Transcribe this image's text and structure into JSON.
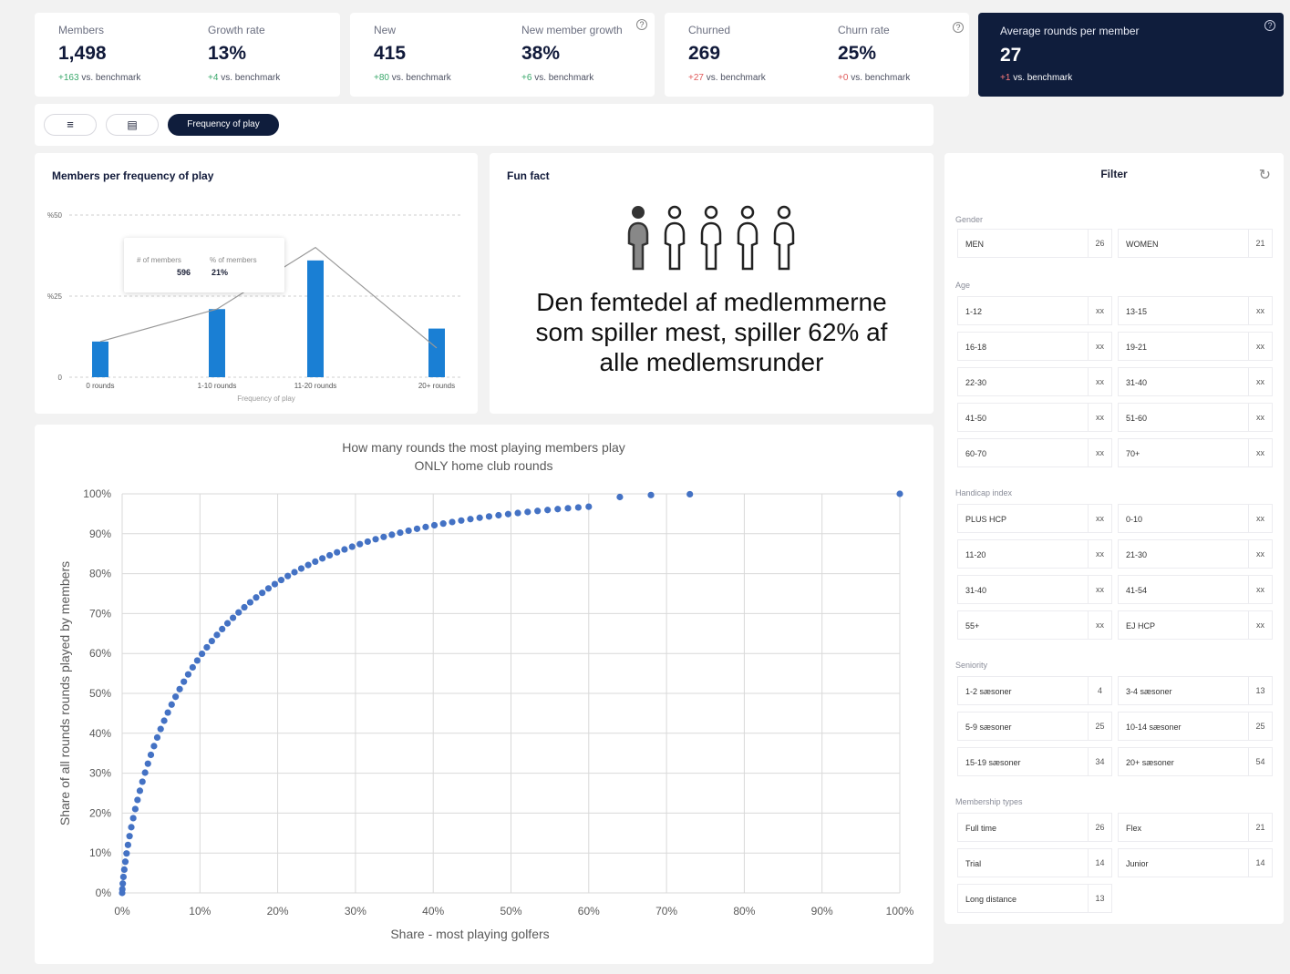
{
  "kpis": {
    "members": {
      "label": "Members",
      "value": "1,498",
      "delta": "+163",
      "suffix": "vs. benchmark"
    },
    "growth_rate": {
      "label": "Growth rate",
      "value": "13%",
      "delta": "+4",
      "suffix": "vs. benchmark"
    },
    "new": {
      "label": "New",
      "value": "415",
      "delta": "+80",
      "suffix": "vs. benchmark"
    },
    "new_member_growth": {
      "label": "New member growth",
      "value": "38%",
      "delta": "+6",
      "suffix": "vs. benchmark"
    },
    "churned": {
      "label": "Churned",
      "value": "269",
      "delta": "+27",
      "suffix": "vs. benchmark"
    },
    "churn_rate": {
      "label": "Churn rate",
      "value": "25%",
      "delta": "+0",
      "suffix": "vs. benchmark"
    },
    "avg_rounds": {
      "label": "Average rounds per member",
      "value": "27",
      "delta": "+1",
      "suffix": "vs. benchmark"
    }
  },
  "toolbar": {
    "list_icon": "list-icon",
    "comment_icon": "comment-icon",
    "active_tab": "Frequency of play"
  },
  "bar_card": {
    "title": "Members per frequency of play",
    "tooltip": {
      "col1_label": "# of members",
      "col2_label": "% of members",
      "col1_value": "596",
      "col2_value": "21%"
    }
  },
  "fun_fact": {
    "title": "Fun fact",
    "text_lines": [
      "Den femtedel af medlemmerne",
      "som spiller mest, spiller 62% af",
      "alle medlemsrunder"
    ]
  },
  "filter": {
    "title": "Filter",
    "reset_icon": "reset-icon",
    "sections": [
      {
        "label": "Gender",
        "options": [
          {
            "name": "MEN",
            "count": "26"
          },
          {
            "name": "WOMEN",
            "count": "21"
          }
        ]
      },
      {
        "label": "Age",
        "options": [
          {
            "name": "1-12",
            "count": "xx"
          },
          {
            "name": "13-15",
            "count": "xx"
          },
          {
            "name": "16-18",
            "count": "xx"
          },
          {
            "name": "19-21",
            "count": "xx"
          },
          {
            "name": "22-30",
            "count": "xx"
          },
          {
            "name": "31-40",
            "count": "xx"
          },
          {
            "name": "41-50",
            "count": "xx"
          },
          {
            "name": "51-60",
            "count": "xx"
          },
          {
            "name": "60-70",
            "count": "xx"
          },
          {
            "name": "70+",
            "count": "xx"
          }
        ]
      },
      {
        "label": "Handicap index",
        "options": [
          {
            "name": "PLUS HCP",
            "count": "xx"
          },
          {
            "name": "0-10",
            "count": "xx"
          },
          {
            "name": "11-20",
            "count": "xx"
          },
          {
            "name": "21-30",
            "count": "xx"
          },
          {
            "name": "31-40",
            "count": "xx"
          },
          {
            "name": "41-54",
            "count": "xx"
          },
          {
            "name": "55+",
            "count": "xx"
          },
          {
            "name": "EJ HCP",
            "count": "xx"
          }
        ]
      },
      {
        "label": "Seniority",
        "options": [
          {
            "name": "1-2 sæsoner",
            "count": "4"
          },
          {
            "name": "3-4 sæsoner",
            "count": "13"
          },
          {
            "name": "5-9 sæsoner",
            "count": "25"
          },
          {
            "name": "10-14 sæsoner",
            "count": "25"
          },
          {
            "name": "15-19 sæsoner",
            "count": "34"
          },
          {
            "name": "20+ sæsoner",
            "count": "54"
          }
        ]
      },
      {
        "label": "Membership types",
        "options": [
          {
            "name": "Full time",
            "count": "26"
          },
          {
            "name": "Flex",
            "count": "21"
          },
          {
            "name": "Trial",
            "count": "14"
          },
          {
            "name": "Junior",
            "count": "14"
          },
          {
            "name": "Long distance",
            "count": "13"
          }
        ]
      }
    ]
  },
  "chart_data": [
    {
      "type": "bar",
      "categories": [
        "0 rounds",
        "1-10 rounds",
        "11-20 rounds",
        "20+ rounds"
      ],
      "values": [
        11,
        21,
        36,
        15
      ],
      "line_values": [
        11,
        21,
        40,
        9
      ],
      "xlabel": "Frequency of play",
      "ylabel": "",
      "ylim": [
        0,
        50
      ],
      "yticks": [
        "0",
        "%25",
        "%50"
      ],
      "bar_color": "#1a7fd4",
      "line_color": "#999999",
      "grid": true
    },
    {
      "type": "scatter",
      "title": "How many rounds the most playing members play",
      "subtitle": "ONLY home club rounds",
      "xlabel": "Share - most playing golfers",
      "ylabel": "Share of all rounds rounds played by members",
      "xlim": [
        0,
        100
      ],
      "ylim": [
        0,
        100
      ],
      "xticks": [
        "0%",
        "10%",
        "20%",
        "30%",
        "40%",
        "50%",
        "60%",
        "70%",
        "80%",
        "90%",
        "100%"
      ],
      "yticks": [
        "0%",
        "10%",
        "20%",
        "30%",
        "40%",
        "50%",
        "60%",
        "70%",
        "80%",
        "90%",
        "100%"
      ],
      "point_color": "#4472c4",
      "grid": true,
      "curve_exponent": 0.4,
      "curve_scale": 3.6,
      "curve_points": 80,
      "extra_points": [
        [
          64,
          99.2
        ],
        [
          68,
          99.7
        ],
        [
          73,
          99.9
        ],
        [
          100,
          100
        ]
      ]
    }
  ]
}
